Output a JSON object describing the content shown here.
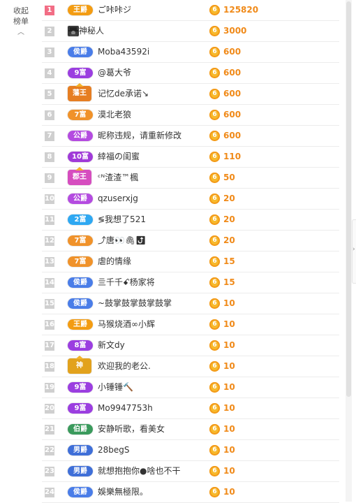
{
  "collapse": {
    "line1": "收起",
    "line2": "榜单",
    "icon": "chevron-up-icon",
    "glyph": "︿"
  },
  "coin_glyph": "6",
  "colors": {
    "first_rank": "#f26d85",
    "rank": "#cfcfcf",
    "amount": "#f08a19",
    "coin": "#f7b92b"
  },
  "rows": [
    {
      "rank": "1",
      "badge": "王爵",
      "badge_color": "#f39c12",
      "crown": false,
      "name": "ご咔咔ジ",
      "amount": "125820"
    },
    {
      "rank": "2",
      "badge": "",
      "badge_color": "",
      "crown": false,
      "mystery": true,
      "name": "神秘人",
      "amount": "3000"
    },
    {
      "rank": "3",
      "badge": "侯爵",
      "badge_color": "#4a7de8",
      "crown": false,
      "name": "Moba43592i",
      "amount": "600"
    },
    {
      "rank": "4",
      "badge": "9富",
      "badge_color": "#9b3ee0",
      "crown": false,
      "name": "@葛大爷",
      "amount": "600"
    },
    {
      "rank": "5",
      "badge": "藩王",
      "badge_color": "#e67e22",
      "crown": true,
      "name": "记忆de承诺↘",
      "amount": "600"
    },
    {
      "rank": "6",
      "badge": "7富",
      "badge_color": "#f0922a",
      "crown": false,
      "name": "漠北老狼",
      "amount": "600"
    },
    {
      "rank": "7",
      "badge": "公爵",
      "badge_color": "#b44be0",
      "crown": false,
      "name": "昵称违规，请重新修改",
      "amount": "600"
    },
    {
      "rank": "8",
      "badge": "10富",
      "badge_color": "#a03ad8",
      "crown": false,
      "name": "緈福の闺蜜",
      "amount": "110"
    },
    {
      "rank": "9",
      "badge": "郡王",
      "badge_color": "#d64dbf",
      "crown": true,
      "name": "ᶜᴺ渣渣™楓",
      "amount": "50"
    },
    {
      "rank": "10",
      "badge": "公爵",
      "badge_color": "#b44be0",
      "crown": false,
      "name": "qzuserxjg",
      "amount": "20"
    },
    {
      "rank": "11",
      "badge": "2富",
      "badge_color": "#2ea8f2",
      "crown": false,
      "name": "≶我想了521",
      "amount": "20"
    },
    {
      "rank": "12",
      "badge": "7富",
      "badge_color": "#f0922a",
      "crown": false,
      "name": "⤴唐👀🖇⤴",
      "amount": "20"
    },
    {
      "rank": "13",
      "badge": "7富",
      "badge_color": "#f0922a",
      "crown": false,
      "name": "虐的情缘",
      "amount": "15"
    },
    {
      "rank": "14",
      "badge": "侯爵",
      "badge_color": "#4a7de8",
      "crown": false,
      "name": "亖千千ꗃ杨家将",
      "amount": "15"
    },
    {
      "rank": "15",
      "badge": "侯爵",
      "badge_color": "#4a7de8",
      "crown": false,
      "name": "~鼓掌鼓掌鼓掌鼓掌",
      "amount": "10"
    },
    {
      "rank": "16",
      "badge": "王爵",
      "badge_color": "#f39c12",
      "crown": false,
      "name": "马猴烧酒∞小辉",
      "amount": "10"
    },
    {
      "rank": "17",
      "badge": "8富",
      "badge_color": "#9b3ee0",
      "crown": false,
      "name": "新文dy",
      "amount": "10"
    },
    {
      "rank": "18",
      "badge": "神",
      "badge_color": "#e2a21d",
      "crown": true,
      "name": "欢迎我的老公.",
      "amount": "10"
    },
    {
      "rank": "19",
      "badge": "9富",
      "badge_color": "#9b3ee0",
      "crown": false,
      "name": "小锤锤🔨",
      "amount": "10"
    },
    {
      "rank": "20",
      "badge": "9富",
      "badge_color": "#9b3ee0",
      "crown": false,
      "name": "Mo9947753h",
      "amount": "10"
    },
    {
      "rank": "21",
      "badge": "伯爵",
      "badge_color": "#3a9a5c",
      "crown": false,
      "name": "安静听歌，看美女",
      "amount": "10"
    },
    {
      "rank": "22",
      "badge": "男爵",
      "badge_color": "#3f6fd8",
      "crown": false,
      "name": "28begS",
      "amount": "10"
    },
    {
      "rank": "23",
      "badge": "男爵",
      "badge_color": "#3f6fd8",
      "crown": false,
      "name": "就想抱抱你●啥也不干",
      "amount": "10"
    },
    {
      "rank": "24",
      "badge": "侯爵",
      "badge_color": "#4a7de8",
      "crown": false,
      "name": "娛樂無極限。",
      "amount": "10"
    }
  ],
  "side_tab": {
    "icon": "chevron-right-icon",
    "glyph": "›"
  }
}
